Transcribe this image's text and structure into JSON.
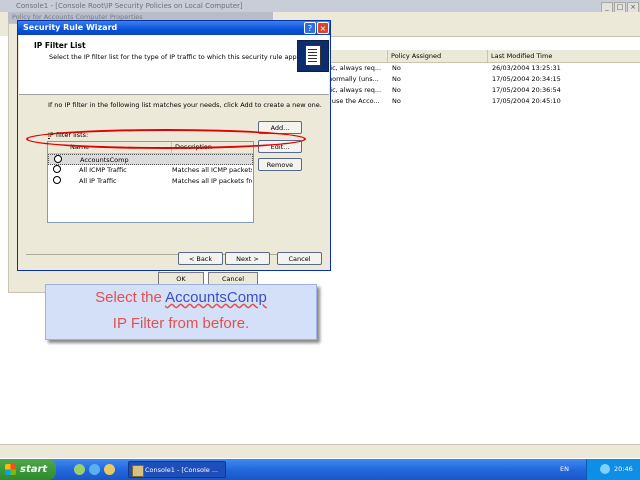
{
  "console": {
    "title": "Console1 - [Console Root\\IP Security Policies on Local Computer]",
    "props_title": "Policy for Accounts Computer Properties",
    "columns": [
      "Policy Assigned",
      "Last Modified Time"
    ],
    "rows": [
      {
        "desc": "fic, always req...",
        "assigned": "No",
        "modified": "26/03/2004 13:25:31"
      },
      {
        "desc": "normally (uns...",
        "assigned": "No",
        "modified": "17/05/2004 20:34:15"
      },
      {
        "desc": "fic, always req...",
        "assigned": "No",
        "modified": "17/05/2004 20:36:54"
      },
      {
        "desc": "l use the Acco...",
        "assigned": "No",
        "modified": "17/05/2004 20:45:10"
      }
    ],
    "ok_label": "OK",
    "cancel_label": "Cancel"
  },
  "dialog": {
    "title": "Security Rule Wizard",
    "header_title": "IP Filter List",
    "header_desc": "Select the IP filter list for the type of IP traffic to which this security rule applies.",
    "info": "If no IP filter in the following list matches your needs, click Add to create a new one.",
    "filters_label_prefix": "I",
    "filters_label_rest": "P filter lists:",
    "list_headers": {
      "name": "Name",
      "description": "Description"
    },
    "filters": [
      {
        "name": "AccountsComp",
        "description": ""
      },
      {
        "name": "All ICMP Traffic",
        "description": "Matches all ICMP packets bet..."
      },
      {
        "name": "All IP Traffic",
        "description": "Matches all IP packets from t..."
      }
    ],
    "add_label": "Add...",
    "edit_label": "Edit...",
    "remove_label": "Remove",
    "back_label": "< Back",
    "next_label": "Next >",
    "cancel_label": "Cancel"
  },
  "caption": {
    "part1": "Select the ",
    "keyword": "AccountsComp",
    "line2": "IP Filter from before."
  },
  "taskbar": {
    "start_label": "start",
    "task_label": "Console1 - [Console ...",
    "language": "EN",
    "clock": "20:46"
  },
  "colors": {
    "titlebar": "#0a53d8",
    "annotation": "#e00000",
    "caption_text": "#e35050",
    "caption_bg": "#d4e0f7"
  }
}
